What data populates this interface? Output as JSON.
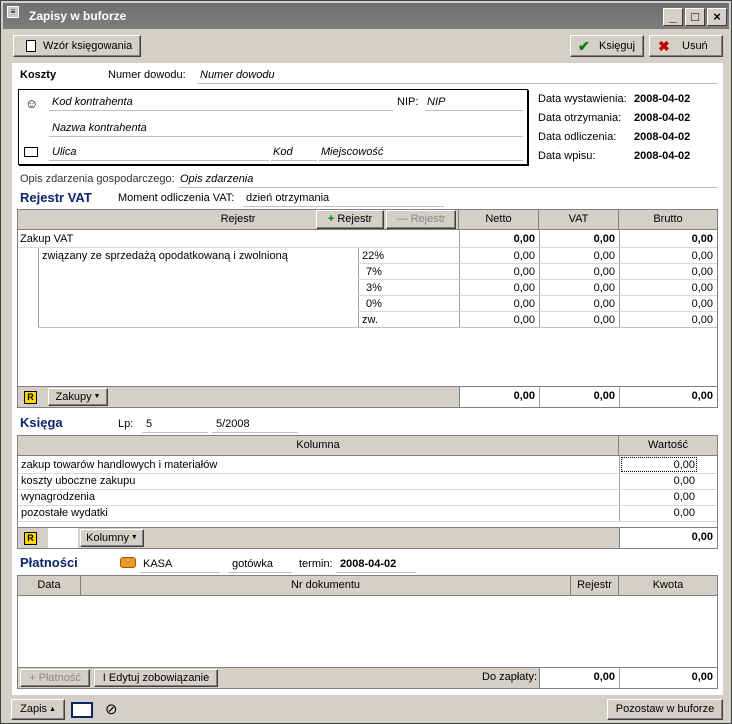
{
  "window": {
    "title": "Zapisy w buforze"
  },
  "toolbar": {
    "template": "Wzór księgowania",
    "post": "Księguj",
    "delete": "Usuń"
  },
  "koszty": {
    "title": "Koszty",
    "doc_label": "Numer dowodu:",
    "doc_value": "Numer dowodu"
  },
  "contractor": {
    "code": "Kod kontrahenta",
    "nip_label": "NIP:",
    "nip": "NIP",
    "name": "Nazwa kontrahenta",
    "street": "Ulica",
    "zip": "Kod",
    "city": "Miejscowość"
  },
  "dates": [
    {
      "label": "Data wystawienia:",
      "value": "2008-04-02"
    },
    {
      "label": "Data otrzymania:",
      "value": "2008-04-02"
    },
    {
      "label": "Data odliczenia:",
      "value": "2008-04-02"
    },
    {
      "label": "Data wpisu:",
      "value": "2008-04-02"
    }
  ],
  "event": {
    "label": "Opis zdarzenia gospodarczego:",
    "value": "Opis zdarzenia"
  },
  "vat": {
    "title": "Rejestr VAT",
    "moment_label": "Moment odliczenia VAT:",
    "moment_value": "dzień otrzymania",
    "cols": {
      "register": "Rejestr",
      "add": "Rejestr",
      "remove": "Rejestr",
      "net": "Netto",
      "vat": "VAT",
      "gross": "Brutto"
    },
    "group": {
      "name": "Zakup VAT",
      "net": "0,00",
      "vat": "0,00",
      "gross": "0,00"
    },
    "subgroup": "związany ze sprzedażą opodatkowaną i zwolnioną",
    "rows": [
      {
        "rate": "22%",
        "net": "0,00",
        "vat": "0,00",
        "gross": "0,00"
      },
      {
        "rate": "7%",
        "net": "0,00",
        "vat": "0,00",
        "gross": "0,00"
      },
      {
        "rate": "3%",
        "net": "0,00",
        "vat": "0,00",
        "gross": "0,00"
      },
      {
        "rate": "0%",
        "net": "0,00",
        "vat": "0,00",
        "gross": "0,00"
      },
      {
        "rate": "zw.",
        "net": "0,00",
        "vat": "0,00",
        "gross": "0,00"
      }
    ],
    "footer": {
      "r": "R",
      "menu": "Zakupy",
      "net": "0,00",
      "vat": "0,00",
      "gross": "0,00"
    }
  },
  "book": {
    "title": "Księga",
    "lp_label": "Lp:",
    "lp": "5",
    "number": "5/2008",
    "col_column": "Kolumna",
    "col_value": "Wartość",
    "rows": [
      {
        "name": "zakup towarów handlowych i materiałów",
        "value": "0,00"
      },
      {
        "name": "koszty uboczne zakupu",
        "value": "0,00"
      },
      {
        "name": "wynagrodzenia",
        "value": "0,00"
      },
      {
        "name": "pozostałe wydatki",
        "value": "0,00"
      }
    ],
    "footer": {
      "r": "R",
      "menu": "Kolumny",
      "total": "0,00"
    }
  },
  "payments": {
    "title": "Płatności",
    "account": "KASA",
    "method": "gotówka",
    "term_label": "termin:",
    "term": "2008-04-02",
    "cols": {
      "date": "Data",
      "doc": "Nr dokumentu",
      "register": "Rejestr",
      "amount": "Kwota"
    },
    "add": "Płatność",
    "edit": "Edytuj zobowiązanie",
    "due_label": "Do zapłaty:",
    "due": "0,00",
    "amount_total": "0,00"
  },
  "bottom": {
    "menu": "Zapis",
    "keep": "Pozostaw w buforze"
  }
}
